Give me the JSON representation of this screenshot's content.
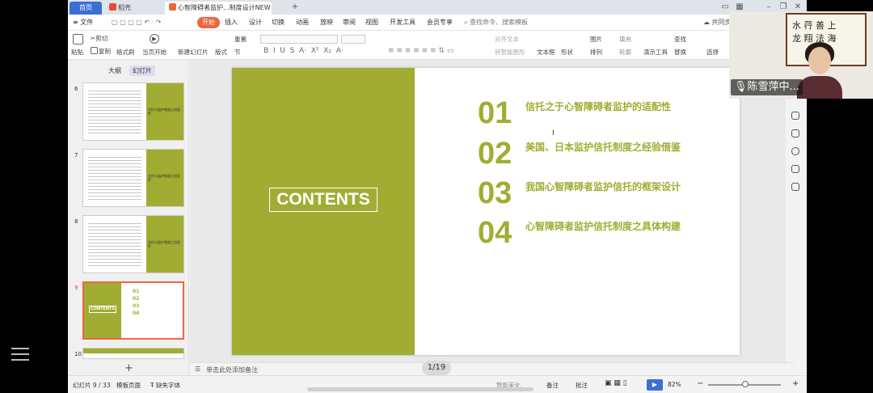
{
  "titlebar": {
    "tab_home": "首页",
    "tab_daoke": "稻壳",
    "tab_doc": "心智障碍者监护...制度设计NEW",
    "new_tab": "+"
  },
  "menubar": {
    "file": "≡ 文件",
    "items": [
      "开始",
      "插入",
      "设计",
      "切换",
      "动画",
      "放映",
      "审阅",
      "视图",
      "开发工具",
      "会员专享"
    ],
    "search": "查找命令、搜索模板",
    "collab": "共同步"
  },
  "ribbon": {
    "paste": "粘贴",
    "cut": "剪切",
    "copy": "复制",
    "format_painter": "格式刷",
    "play_current": "当页开始",
    "new_slide": "新建幻灯片",
    "layout": "版式",
    "section": "节",
    "reset": "重置",
    "text_box": "文本框",
    "shape": "形状",
    "arrange": "排列",
    "present_tools": "演示工具",
    "find": "查找",
    "replace": "替换",
    "select": "选择",
    "picture": "图片",
    "fill": "填充",
    "outline": "轮廓",
    "align_text": "对齐文本",
    "convert_smartart": "转智能图形"
  },
  "panel": {
    "tab_outline": "大纲",
    "tab_slides": "幻灯片",
    "thumb_numbers": [
      "6",
      "7",
      "8",
      "9",
      "10"
    ],
    "thumb_title_text": "信托与监护制度之适配性",
    "add": "+"
  },
  "slide": {
    "contents": "CONTENTS",
    "items": [
      {
        "num": "01",
        "text": "信托之于心智障碍者监护的适配性"
      },
      {
        "num": "02",
        "text": "美国、日本监护信托制度之经验借鉴"
      },
      {
        "num": "03",
        "text": "我国心智障碍者监护信托的框架设计"
      },
      {
        "num": "04",
        "text": "心智障碍者监护信托制度之具体构建"
      }
    ],
    "thumb_contents": "CONTENTS",
    "thumb_nums": [
      "01",
      "02",
      "03",
      "04"
    ]
  },
  "notes": {
    "placeholder": "单击此处添加备注"
  },
  "page_indicator": "1/19",
  "statusbar": {
    "slide_info": "幻灯片 9 / 33",
    "template": "模板页面",
    "missing_font": "缺失字体",
    "smart_beautify": "智能美化",
    "notes": "备注",
    "comments": "批注",
    "zoom": "82%"
  },
  "video": {
    "name": "陈雪萍中...",
    "calligraphy_line1": "水 荇 善 上",
    "calligraphy_line2": "龙 翔 法 海"
  },
  "colors": {
    "accent_green": "#a1ad32",
    "active_tab": "#f2643c",
    "home_tab": "#3b6fd1"
  }
}
